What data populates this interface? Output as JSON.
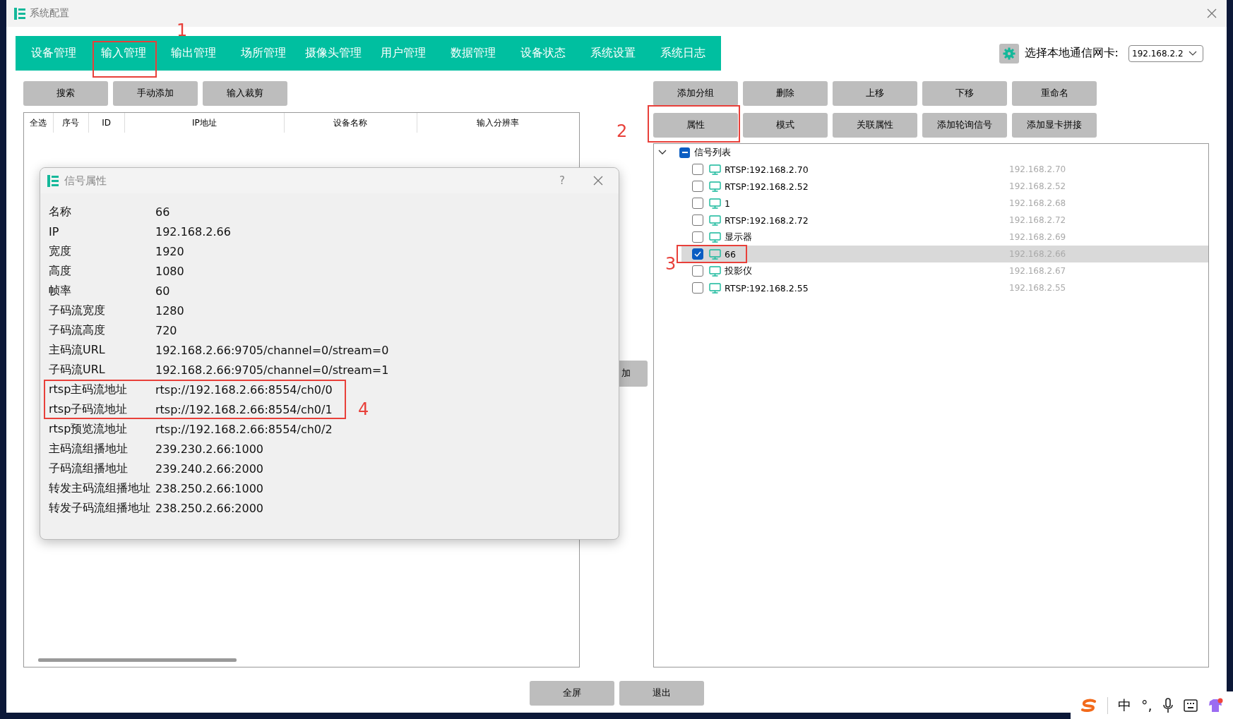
{
  "window": {
    "title": "系统配置"
  },
  "tabs": [
    {
      "label": "设备管理"
    },
    {
      "label": "输入管理",
      "annotation": "1"
    },
    {
      "label": "输出管理"
    },
    {
      "label": "场所管理"
    },
    {
      "label": "摄像头管理"
    },
    {
      "label": "用户管理"
    },
    {
      "label": "数据管理"
    },
    {
      "label": "设备状态"
    },
    {
      "label": "系统设置"
    },
    {
      "label": "系统日志"
    }
  ],
  "network_card": {
    "label": "选择本地通信网卡:",
    "value": "192.168.2.2"
  },
  "left_buttons": [
    "搜索",
    "手动添加",
    "输入裁剪"
  ],
  "input_table": {
    "columns": [
      "全选",
      "序号",
      "ID",
      "IP地址",
      "设备名称",
      "输入分辨率"
    ]
  },
  "hidden_button": {
    "label": "加"
  },
  "right_buttons": [
    {
      "label": "添加分组"
    },
    {
      "label": "删除"
    },
    {
      "label": "上移"
    },
    {
      "label": "下移"
    },
    {
      "label": "重命名"
    },
    {
      "label": "属性",
      "annotation": "2"
    },
    {
      "label": "模式"
    },
    {
      "label": "关联属性"
    },
    {
      "label": "添加轮询信号"
    },
    {
      "label": "添加显卡拼接"
    }
  ],
  "signal_tree": {
    "label": "信号列表",
    "expanded": true,
    "partial": true,
    "children": [
      {
        "name": "RTSP:192.168.2.70",
        "ip": "192.168.2.70",
        "checked": false,
        "selected": false
      },
      {
        "name": "RTSP:192.168.2.52",
        "ip": "192.168.2.52",
        "checked": false,
        "selected": false
      },
      {
        "name": "1",
        "ip": "192.168.2.68",
        "checked": false,
        "selected": false
      },
      {
        "name": "RTSP:192.168.2.72",
        "ip": "192.168.2.72",
        "checked": false,
        "selected": false
      },
      {
        "name": "显示器",
        "ip": "192.168.2.69",
        "checked": false,
        "selected": false
      },
      {
        "name": "66",
        "ip": "192.168.2.66",
        "checked": true,
        "selected": true,
        "annotation": "3"
      },
      {
        "name": "投影仪",
        "ip": "192.168.2.67",
        "checked": false,
        "selected": false
      },
      {
        "name": "RTSP:192.168.2.55",
        "ip": "192.168.2.55",
        "checked": false,
        "selected": false
      }
    ]
  },
  "bottom_buttons": [
    "全屏",
    "退出"
  ],
  "dialog": {
    "title": "信号属性",
    "help": "?",
    "annotation": "4",
    "rows": [
      {
        "label": "名称",
        "value": "66",
        "highlighted": false
      },
      {
        "label": "IP",
        "value": "192.168.2.66",
        "highlighted": false
      },
      {
        "label": "宽度",
        "value": "1920",
        "highlighted": false
      },
      {
        "label": "高度",
        "value": "1080",
        "highlighted": false
      },
      {
        "label": "帧率",
        "value": "60",
        "highlighted": false
      },
      {
        "label": "子码流宽度",
        "value": "1280",
        "highlighted": false
      },
      {
        "label": "子码流高度",
        "value": "720",
        "highlighted": false
      },
      {
        "label": "主码流URL",
        "value": "192.168.2.66:9705/channel=0/stream=0",
        "highlighted": false
      },
      {
        "label": "子码流URL",
        "value": "192.168.2.66:9705/channel=0/stream=1",
        "highlighted": false
      },
      {
        "label": "rtsp主码流地址",
        "value": "rtsp://192.168.2.66:8554/ch0/0",
        "highlighted": true
      },
      {
        "label": "rtsp子码流地址",
        "value": "rtsp://192.168.2.66:8554/ch0/1",
        "highlighted": true
      },
      {
        "label": "rtsp预览流地址",
        "value": "rtsp://192.168.2.66:8554/ch0/2",
        "highlighted": false
      },
      {
        "label": "主码流组播地址",
        "value": "239.230.2.66:1000",
        "highlighted": false
      },
      {
        "label": "子码流组播地址",
        "value": "239.240.2.66:2000",
        "highlighted": false
      },
      {
        "label": "转发主码流组播地址",
        "value": "238.250.2.66:1000",
        "highlighted": false
      },
      {
        "label": "转发子码流组播地址",
        "value": "238.250.2.66:2000",
        "highlighted": false
      }
    ]
  },
  "ime_toolbar": {
    "items": [
      {
        "kind": "logo"
      },
      {
        "kind": "text",
        "label": "中"
      },
      {
        "kind": "text",
        "label": "°,"
      },
      {
        "kind": "mic"
      },
      {
        "kind": "keyboard"
      },
      {
        "kind": "skin"
      }
    ]
  }
}
